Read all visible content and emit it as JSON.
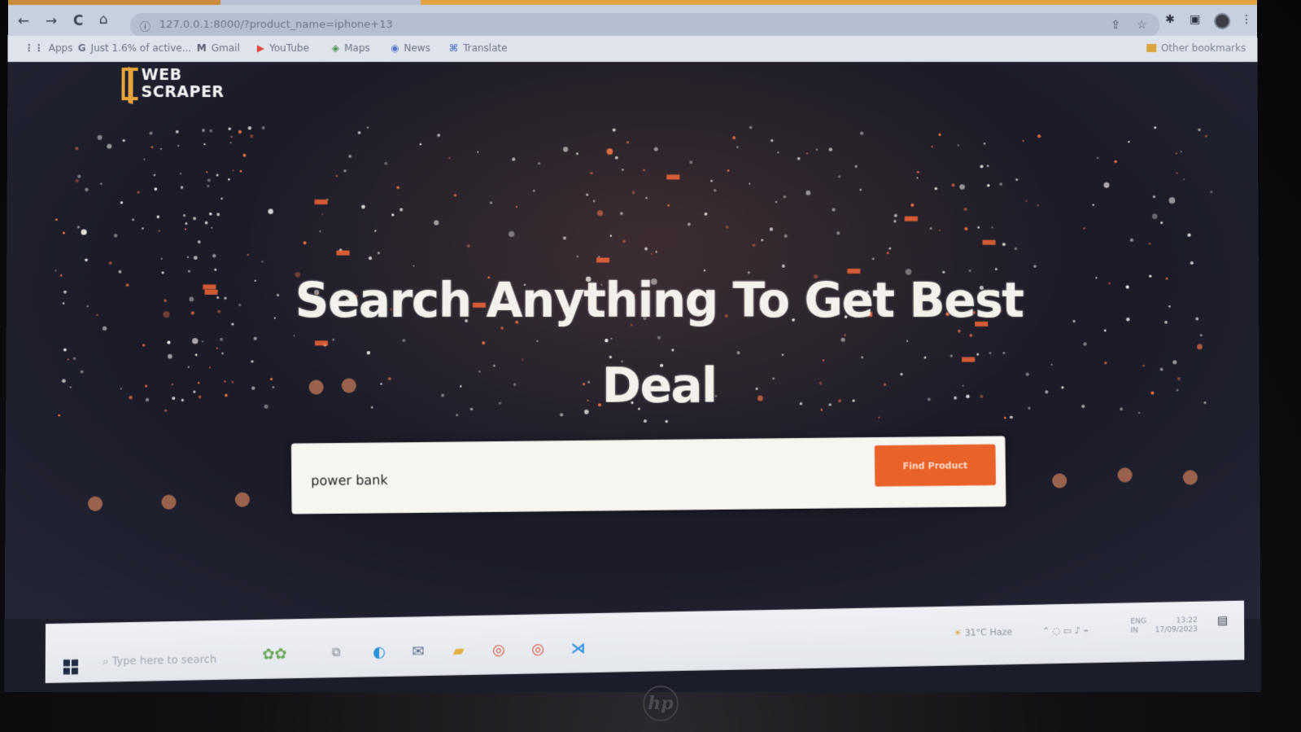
{
  "browser": {
    "url": "127.0.0.1:8000/?product_name=iphone+13",
    "nav": {
      "back_icon": "←",
      "forward_icon": "→",
      "reload_icon": "C",
      "home_icon": "⌂"
    },
    "bookmarks": [
      {
        "icon": "apps-grid-icon",
        "glyph": "⋮⋮",
        "label": "Apps"
      },
      {
        "icon": "google-icon",
        "glyph": "G",
        "label": "Just 1.6% of active..."
      },
      {
        "icon": "gmail-icon",
        "glyph": "M",
        "label": "Gmail"
      },
      {
        "icon": "youtube-icon",
        "glyph": "▶",
        "label": "YouTube"
      },
      {
        "icon": "maps-icon",
        "glyph": "◈",
        "label": "Maps"
      },
      {
        "icon": "news-icon",
        "glyph": "◉",
        "label": "News"
      },
      {
        "icon": "translate-icon",
        "glyph": "⌘",
        "label": "Translate"
      }
    ],
    "other_bookmarks": "Other bookmarks"
  },
  "page": {
    "logo": {
      "line1": "WEB",
      "line2": "SCRAPER"
    },
    "headline": "Search Anything To Get Best Deal",
    "search": {
      "value": "power bank",
      "button_label": "Find Product"
    }
  },
  "taskbar": {
    "search_placeholder": "Type here to search",
    "weather": "31°C Haze",
    "lang_line1": "ENG",
    "lang_line2": "IN",
    "time": "13:22",
    "date": "17/09/2023"
  },
  "hardware": {
    "brand": "hp"
  },
  "colors": {
    "accent": "#e8622a",
    "logo": "#e6a53a",
    "page_bg": "#1e1e2b"
  }
}
